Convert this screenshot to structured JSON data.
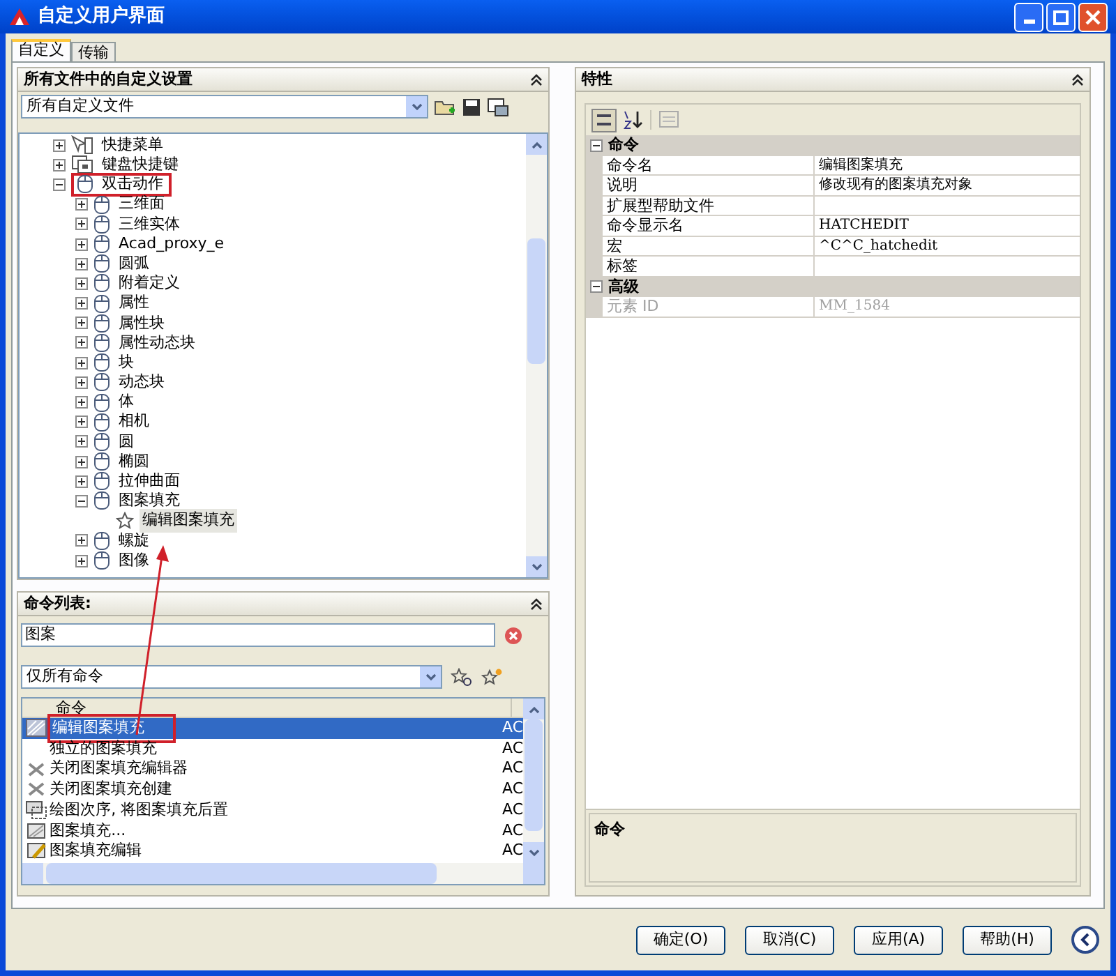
{
  "window": {
    "title": "自定义用户界面"
  },
  "tabs": [
    {
      "label": "自定义",
      "selected": true
    },
    {
      "label": "传输",
      "selected": false
    }
  ],
  "customizations_panel": {
    "title": "所有文件中的自定义设置",
    "file_select": {
      "value": "所有自定义文件"
    },
    "tree": [
      {
        "label": "快捷菜单",
        "kind": "menu",
        "expanded": false,
        "annotated": false
      },
      {
        "label": "键盘快捷键",
        "kind": "keyboard",
        "expanded": false,
        "annotated": false
      },
      {
        "label": "双击动作",
        "kind": "mouse",
        "expanded": true,
        "annotated": true,
        "children": [
          {
            "label": "三维面",
            "kind": "mouse",
            "expanded": false,
            "annotated": false
          },
          {
            "label": "三维实体",
            "kind": "mouse",
            "expanded": false,
            "annotated": false
          },
          {
            "label": "Acad_proxy_e",
            "kind": "mouse",
            "expanded": false,
            "annotated": false
          },
          {
            "label": "圆弧",
            "kind": "mouse",
            "expanded": false,
            "annotated": false
          },
          {
            "label": "附着定义",
            "kind": "mouse",
            "expanded": false,
            "annotated": false
          },
          {
            "label": "属性",
            "kind": "mouse",
            "expanded": false,
            "annotated": false
          },
          {
            "label": "属性块",
            "kind": "mouse",
            "expanded": false,
            "annotated": false
          },
          {
            "label": "属性动态块",
            "kind": "mouse",
            "expanded": false,
            "annotated": false
          },
          {
            "label": "块",
            "kind": "mouse",
            "expanded": false,
            "annotated": false
          },
          {
            "label": "动态块",
            "kind": "mouse",
            "expanded": false,
            "annotated": false
          },
          {
            "label": "体",
            "kind": "mouse",
            "expanded": false,
            "annotated": false
          },
          {
            "label": "相机",
            "kind": "mouse",
            "expanded": false,
            "annotated": false
          },
          {
            "label": "圆",
            "kind": "mouse",
            "expanded": false,
            "annotated": false
          },
          {
            "label": "椭圆",
            "kind": "mouse",
            "expanded": false,
            "annotated": false
          },
          {
            "label": "拉伸曲面",
            "kind": "mouse",
            "expanded": false,
            "annotated": false
          },
          {
            "label": "图案填充",
            "kind": "mouse",
            "expanded": true,
            "annotated": false,
            "children": [
              {
                "label": "编辑图案填充",
                "kind": "command",
                "selected": true,
                "annotated": false
              }
            ]
          },
          {
            "label": "螺旋",
            "kind": "mouse",
            "expanded": false,
            "annotated": false
          },
          {
            "label": "图像",
            "kind": "mouse",
            "expanded": false,
            "annotated": false
          }
        ]
      }
    ]
  },
  "command_list_panel": {
    "title": "命令列表:",
    "search": {
      "value": "图案"
    },
    "filter_select": {
      "value": "仅所有命令"
    },
    "columns": [
      "命令"
    ],
    "rows": [
      {
        "name": "编辑图案填充",
        "source": "AC",
        "kind": "hatch",
        "selected": true,
        "annotated": true
      },
      {
        "name": "独立的图案填充",
        "source": "AC",
        "kind": "plain",
        "selected": false,
        "annotated": false
      },
      {
        "name": "关闭图案填充编辑器",
        "source": "AC",
        "kind": "close",
        "selected": false,
        "annotated": false
      },
      {
        "name": "关闭图案填充创建",
        "source": "AC",
        "kind": "close",
        "selected": false,
        "annotated": false
      },
      {
        "name": "绘图次序, 将图案填充后置",
        "source": "AC",
        "kind": "order",
        "selected": false,
        "annotated": false
      },
      {
        "name": "图案填充...",
        "source": "AC",
        "kind": "hatchbox",
        "selected": false,
        "annotated": false
      },
      {
        "name": "图案填充编辑",
        "source": "AC",
        "kind": "hatchedit",
        "selected": false,
        "annotated": false
      }
    ]
  },
  "properties_panel": {
    "title": "特性",
    "categories": [
      {
        "name": "命令",
        "expanded": true,
        "rows": [
          {
            "label": "命令名",
            "value": "编辑图案填充",
            "disabled": false
          },
          {
            "label": "说明",
            "value": "修改现有的图案填充对象",
            "disabled": false
          },
          {
            "label": "扩展型帮助文件",
            "disabled": false
          },
          {
            "label": "命令显示名",
            "value": "HATCHEDIT",
            "disabled": false
          },
          {
            "label": "宏",
            "value": "^C^C_hatchedit",
            "disabled": false
          },
          {
            "label": "标签",
            "disabled": false
          }
        ]
      },
      {
        "name": "高级",
        "expanded": true,
        "rows": [
          {
            "label": "元素 ID",
            "value": "MM_1584",
            "disabled": true
          }
        ]
      }
    ],
    "description": {
      "title": "命令"
    }
  },
  "buttons": [
    {
      "label": "确定(O)"
    },
    {
      "label": "取消(C)"
    },
    {
      "label": "应用(A)"
    },
    {
      "label": "帮助(H)"
    }
  ]
}
